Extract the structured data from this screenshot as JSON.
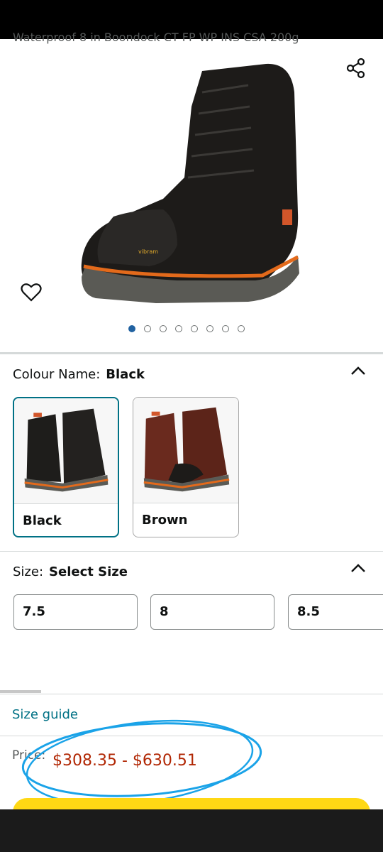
{
  "product": {
    "title_partial": "Waterproof 8 in Boondock CT FP WP INS CSA 200g",
    "image_dots_total": 8,
    "image_dots_active": 0
  },
  "colour": {
    "label": "Colour Name:",
    "selected": "Black",
    "options": [
      {
        "name": "Black"
      },
      {
        "name": "Brown"
      }
    ]
  },
  "size": {
    "label": "Size:",
    "selected": "Select Size",
    "options": [
      "7.5",
      "8",
      "8.5"
    ]
  },
  "links": {
    "size_guide": "Size guide"
  },
  "price": {
    "label": "Price:",
    "range": "$308.35 - $630.51"
  },
  "colors": {
    "link": "#007185",
    "price": "#b12704",
    "accent_dot": "#2162a1",
    "annotation": "#1aa3e8",
    "buy_button": "#ffd814"
  },
  "icons": {
    "share": "share-icon",
    "wishlist": "heart-icon",
    "collapse": "chevron-up-icon"
  }
}
